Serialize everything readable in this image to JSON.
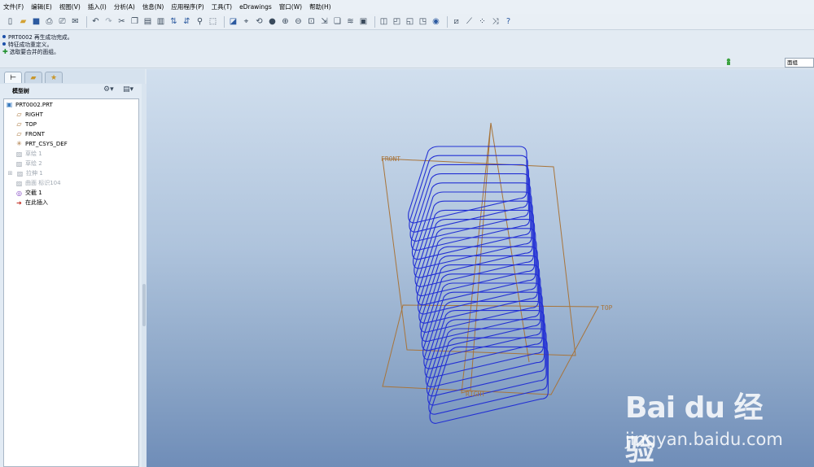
{
  "menu": [
    "文件(F)",
    "编辑(E)",
    "视图(V)",
    "插入(I)",
    "分析(A)",
    "信息(N)",
    "应用程序(P)",
    "工具(T)",
    "eDrawings",
    "窗口(W)",
    "帮助(H)"
  ],
  "toolbar_icons": [
    "new-file-icon",
    "open-folder-icon",
    "save-icon",
    "print-icon",
    "print-preview-icon",
    "email-icon",
    "undo-icon",
    "redo-icon",
    "cut-icon",
    "copy-icon",
    "paste-icon",
    "paste-special-icon",
    "regenerate-icon",
    "regenerate-manager-icon",
    "find-icon",
    "select-box-icon",
    "repaint-icon",
    "spin-center-icon",
    "orient-icon",
    "appearance-icon",
    "zoom-in-icon",
    "zoom-out-icon",
    "refit-icon",
    "reorient-icon",
    "saved-views-icon",
    "layers-icon",
    "view-manager-icon",
    "shading-icon",
    "hidden-line-icon",
    "no-hidden-icon",
    "wireframe-icon",
    "datum-display-icon",
    "datum-planes-icon",
    "datum-axes-icon",
    "datum-points-icon",
    "coordinate-systems-icon",
    "context-help-icon"
  ],
  "messages": [
    {
      "icon": "info-bullet-icon",
      "text": "PRT0002 再生成功完成。"
    },
    {
      "icon": "info-bullet-icon",
      "text": "特征成功重定义。"
    },
    {
      "icon": "prompt-arrow-icon",
      "text": "选取要合并的面组。"
    }
  ],
  "filter": {
    "value": "面组"
  },
  "model_tree": {
    "title": "模型树",
    "items": [
      {
        "label": "PRT0002.PRT",
        "icon": "part-icon",
        "dim": false
      },
      {
        "label": "RIGHT",
        "icon": "datum-plane-icon",
        "dim": false
      },
      {
        "label": "TOP",
        "icon": "datum-plane-icon",
        "dim": false
      },
      {
        "label": "FRONT",
        "icon": "datum-plane-icon",
        "dim": false
      },
      {
        "label": "PRT_CSYS_DEF",
        "icon": "csys-icon",
        "dim": false
      },
      {
        "label": "草绘 1",
        "icon": "sketch-icon",
        "dim": true
      },
      {
        "label": "草绘 2",
        "icon": "sketch-icon",
        "dim": true
      },
      {
        "label": "拉伸 1",
        "icon": "extrude-icon",
        "dim": true
      },
      {
        "label": "曲面 标识104",
        "icon": "surface-icon",
        "dim": true
      },
      {
        "label": "交截 1",
        "icon": "intersect-icon",
        "dim": false
      },
      {
        "label": "在此插入",
        "icon": "insert-here-icon",
        "dim": false
      }
    ]
  },
  "viewport": {
    "plane_labels": {
      "front": "FRONT",
      "top": "TOP",
      "right": "RIGHT"
    },
    "colors": {
      "datum": "#a8743a",
      "curve": "#2330d4"
    }
  },
  "watermark": {
    "logo": "Bai du 经验",
    "url": "jingyan.baidu.com"
  }
}
